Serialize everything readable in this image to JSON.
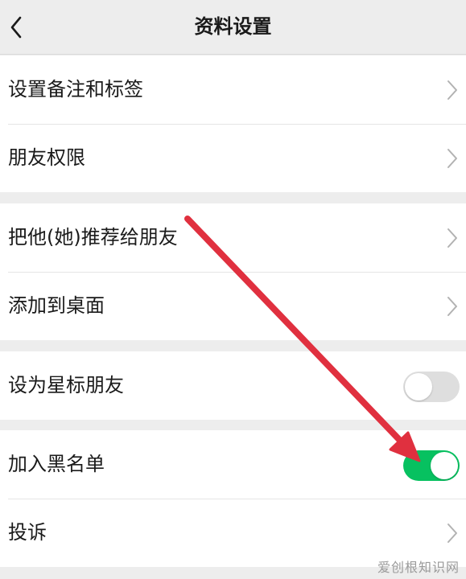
{
  "header": {
    "title": "资料设置",
    "back_icon": "chevron-left-icon"
  },
  "groups": [
    {
      "items": [
        {
          "label": "设置备注和标签",
          "control": "chevron"
        },
        {
          "label": "朋友权限",
          "control": "chevron"
        }
      ]
    },
    {
      "items": [
        {
          "label": "把他(她)推荐给朋友",
          "control": "chevron"
        },
        {
          "label": "添加到桌面",
          "control": "chevron"
        }
      ]
    },
    {
      "items": [
        {
          "label": "设为星标朋友",
          "control": "toggle",
          "checked": false
        }
      ]
    },
    {
      "items": [
        {
          "label": "加入黑名单",
          "control": "toggle",
          "checked": true
        },
        {
          "label": "投诉",
          "control": "chevron"
        }
      ]
    }
  ],
  "watermark": "爱创根知识网",
  "colors": {
    "background": "#ededed",
    "toggle_on": "#07c160",
    "toggle_off": "#dedede",
    "annotation_arrow": "#e0303f"
  }
}
